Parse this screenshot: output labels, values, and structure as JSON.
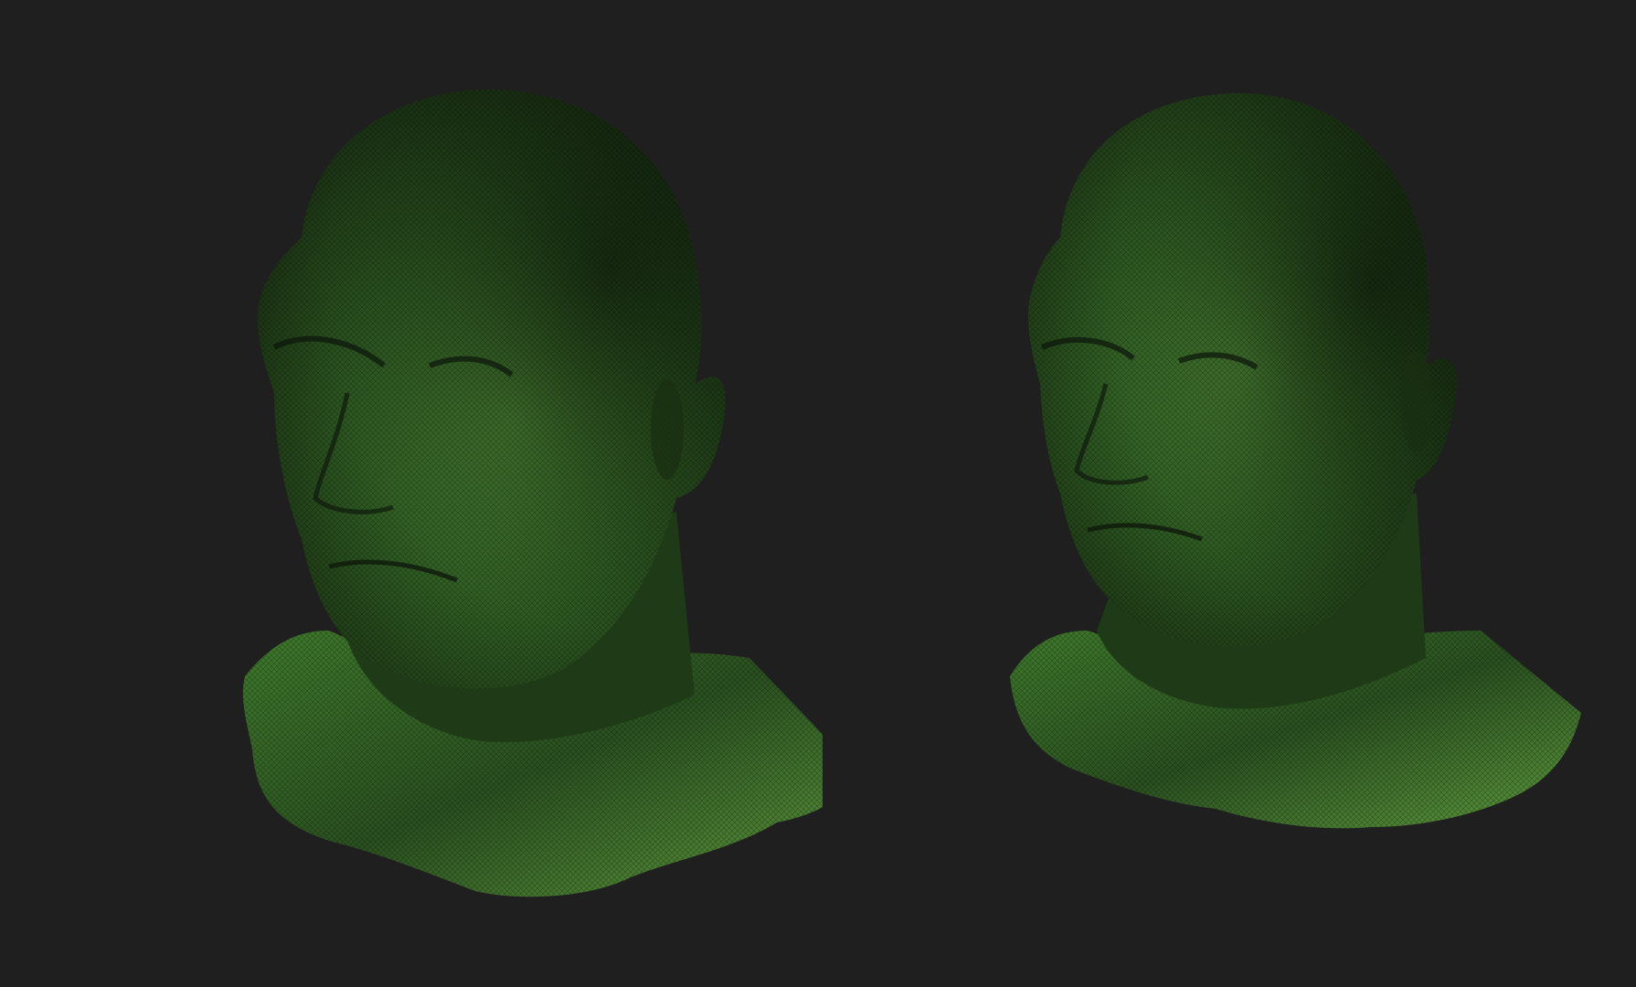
{
  "viewport": {
    "background": "#1f1f1f"
  },
  "models": [
    {
      "name": "bust-left",
      "icon": "head-bust-mesh",
      "base_color": "#2e5a22",
      "highlight_color": "#6fa94a",
      "shadow_color": "#0f1a0b"
    },
    {
      "name": "bust-right",
      "icon": "head-bust-mesh",
      "base_color": "#2e5a22",
      "highlight_color": "#6fa94a",
      "shadow_color": "#0f1a0b"
    }
  ]
}
